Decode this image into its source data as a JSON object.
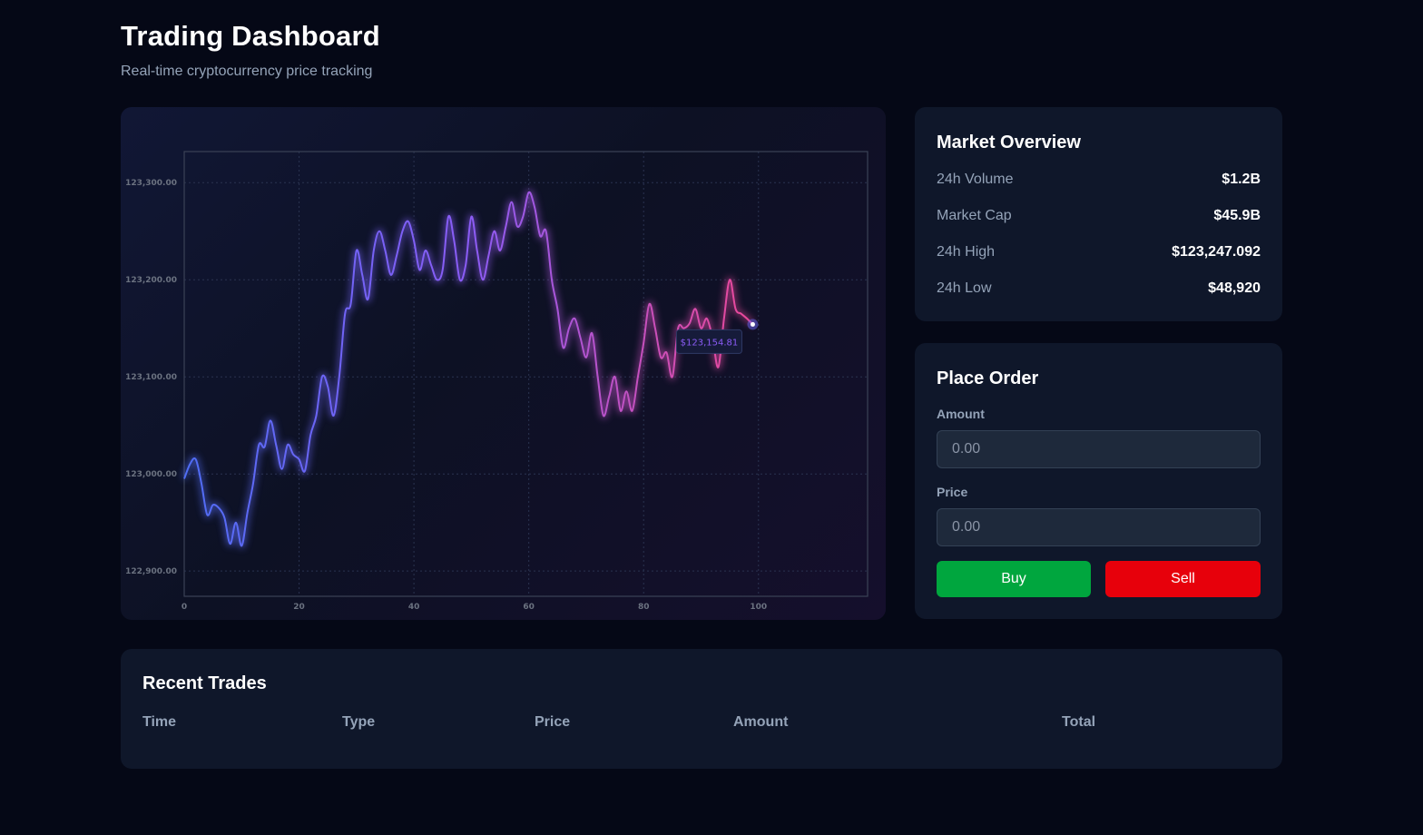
{
  "header": {
    "title": "Trading Dashboard",
    "subtitle": "Real-time cryptocurrency price tracking"
  },
  "chart_data": {
    "type": "line",
    "x": [
      0,
      1,
      2,
      3,
      4,
      5,
      6,
      7,
      8,
      9,
      10,
      11,
      12,
      13,
      14,
      15,
      16,
      17,
      18,
      19,
      20,
      21,
      22,
      23,
      24,
      25,
      26,
      27,
      28,
      29,
      30,
      31,
      32,
      33,
      34,
      35,
      36,
      37,
      38,
      39,
      40,
      41,
      42,
      43,
      44,
      45,
      46,
      47,
      48,
      49,
      50,
      51,
      52,
      53,
      54,
      55,
      56,
      57,
      58,
      59,
      60,
      61,
      62,
      63,
      64,
      65,
      66,
      67,
      68,
      69,
      70,
      71,
      72,
      73,
      74,
      75,
      76,
      77,
      78,
      79,
      80,
      81,
      82,
      83,
      84,
      85,
      86,
      87,
      88,
      89,
      90,
      91,
      92,
      93,
      94,
      95,
      96,
      97,
      98,
      99,
      100,
      101,
      102,
      103,
      104,
      105,
      106,
      107,
      108,
      109,
      110,
      111,
      112,
      113,
      114,
      115,
      116,
      117,
      118,
      119
    ],
    "series": [
      {
        "values": [
          122995,
          123010,
          123015,
          122990,
          122958,
          122968,
          122965,
          122955,
          122928,
          122950,
          122926,
          122960,
          122990,
          123030,
          123028,
          123055,
          123030,
          123005,
          123030,
          123020,
          123015,
          123003,
          123040,
          123060,
          123100,
          123090,
          123060,
          123100,
          123165,
          123175,
          123230,
          123205,
          123180,
          123230,
          123250,
          123230,
          123205,
          123225,
          123250,
          123260,
          123240,
          123210,
          123230,
          123215,
          123200,
          123210,
          123265,
          123240,
          123200,
          123215,
          123265,
          123230,
          123200,
          123225,
          123250,
          123230,
          123255,
          123280,
          123255,
          123265,
          123290,
          123275,
          123245,
          123250,
          123200,
          123170,
          123130,
          123150,
          123160,
          123140,
          123120,
          123145,
          123100,
          123060,
          123080,
          123100,
          123065,
          123085,
          123065,
          123100,
          123135,
          123175,
          123150,
          123120,
          123125,
          123100,
          123150,
          123150,
          123155,
          123170,
          123150,
          123160,
          123140,
          123110,
          123160,
          123200,
          123170,
          123165,
          123160,
          123154
        ],
        "color_start": "#4f6df5",
        "color_end": "#ec4899"
      }
    ],
    "x_ticks": [
      0,
      20,
      40,
      60,
      80,
      100
    ],
    "y_ticks": [
      122900,
      123000,
      123100,
      123200,
      123300
    ],
    "y_tick_labels": [
      "122,900.00",
      "123,000.00",
      "123,100.00",
      "123,200.00",
      "123,300.00"
    ],
    "xlim": [
      0,
      119
    ],
    "ylim": [
      122874,
      123332
    ],
    "grid": true,
    "tooltip": "$123,154.81"
  },
  "overview": {
    "title": "Market Overview",
    "stats": [
      {
        "label": "24h Volume",
        "value": "$1.2B"
      },
      {
        "label": "Market Cap",
        "value": "$45.9B"
      },
      {
        "label": "24h High",
        "value": "$123,247.092"
      },
      {
        "label": "24h Low",
        "value": "$48,920"
      }
    ]
  },
  "order": {
    "title": "Place Order",
    "amount_label": "Amount",
    "amount_placeholder": "0.00",
    "price_label": "Price",
    "price_placeholder": "0.00",
    "buy_label": "Buy",
    "sell_label": "Sell",
    "buy_color": "#00a63e",
    "sell_color": "#e7000b"
  },
  "trades": {
    "title": "Recent Trades",
    "columns": [
      "Time",
      "Type",
      "Price",
      "Amount",
      "Total"
    ]
  }
}
